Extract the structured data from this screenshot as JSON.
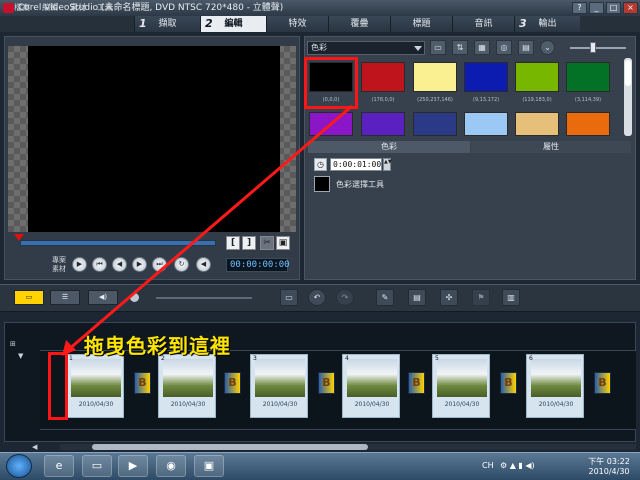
{
  "window": {
    "title": "Corel VideoStudio (未命名標題, DVD NTSC 720*480 - 立體聲)",
    "buttons": [
      "?",
      "_",
      "□",
      "×"
    ]
  },
  "menu": [
    "檔案",
    "編輯",
    "素材",
    "工具"
  ],
  "steps": [
    {
      "num": "1",
      "label": "擷取"
    },
    {
      "num": "2",
      "label": "編輯",
      "active": true
    },
    {
      "num": "",
      "label": "特效"
    },
    {
      "num": "",
      "label": "覆疊"
    },
    {
      "num": "",
      "label": "標題"
    },
    {
      "num": "",
      "label": "音訊"
    },
    {
      "num": "3",
      "label": "輸出"
    }
  ],
  "preview": {
    "mode_label_1": "專案",
    "mode_label_2": "素材",
    "timecode": "00:00:00:00",
    "bracket_in": "[",
    "bracket_out": "]"
  },
  "library": {
    "category": "色彩",
    "swatches": [
      {
        "color": "#000000",
        "caption": "(0,0,0)"
      },
      {
        "color": "#c0141c",
        "caption": "(178,0,0)"
      },
      {
        "color": "#faf092",
        "caption": "(250,237,146)"
      },
      {
        "color": "#0d1cb0",
        "caption": "(9,13,172)"
      },
      {
        "color": "#77b700",
        "caption": "(119,183,0)"
      },
      {
        "color": "#037227",
        "caption": "(3,114,39)"
      },
      {
        "color": "#8a16c8",
        "caption": ""
      },
      {
        "color": "#5a21c0",
        "caption": ""
      },
      {
        "color": "#2a3a86",
        "caption": ""
      },
      {
        "color": "#9bc8f5",
        "caption": ""
      },
      {
        "color": "#e6c07a",
        "caption": ""
      },
      {
        "color": "#ea6a0e",
        "caption": ""
      }
    ]
  },
  "options": {
    "tab_color": "色彩",
    "tab_attributes": "屬性",
    "duration": "0:00:01:00",
    "picker_label": "色彩選擇工具"
  },
  "timeline": {
    "annotation": "拖曳色彩到這裡",
    "clips": [
      {
        "num": "1",
        "date": "2010/04/30"
      },
      {
        "num": "2",
        "date": "2010/04/30"
      },
      {
        "num": "3",
        "date": "2010/04/30"
      },
      {
        "num": "4",
        "date": "2010/04/30"
      },
      {
        "num": "5",
        "date": "2010/04/30"
      },
      {
        "num": "6",
        "date": "2010/04/30"
      }
    ]
  },
  "taskbar": {
    "language": "CH",
    "time": "下午 03:22",
    "date": "2010/4/30"
  }
}
